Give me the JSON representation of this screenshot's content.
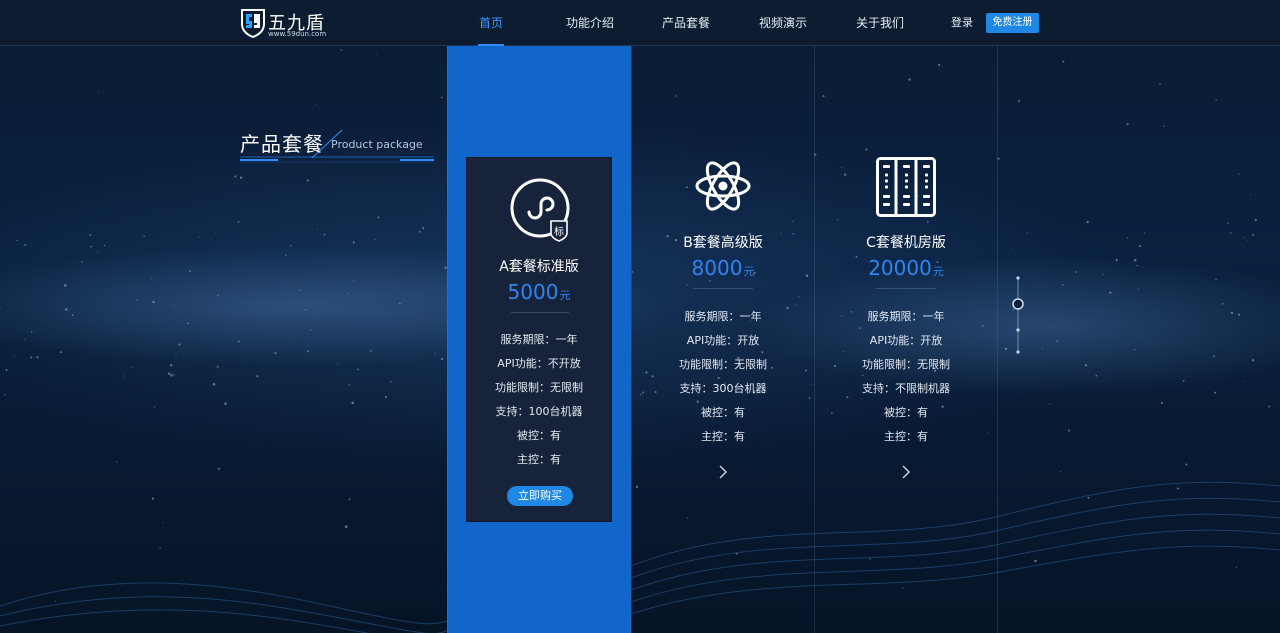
{
  "brand": {
    "name": "五九盾",
    "url": "www.59dun.com",
    "accent": "#1f88e5",
    "highlight": "#1265c9"
  },
  "nav": {
    "items": [
      {
        "label": "首页",
        "active": true
      },
      {
        "label": "功能介绍",
        "active": false
      },
      {
        "label": "产品套餐",
        "active": false
      },
      {
        "label": "视频演示",
        "active": false
      },
      {
        "label": "关于我们",
        "active": false
      }
    ],
    "login": "登录",
    "register": "免费注册"
  },
  "section": {
    "title": "产品套餐",
    "subtitle": "Product package"
  },
  "plans": [
    {
      "icon": "mini-program-icon",
      "badge": "标",
      "name": "A套餐标准版",
      "price": "5000",
      "unit": "元",
      "features": [
        "服务期限：一年",
        "API功能：不开放",
        "功能限制：无限制",
        "支持：100台机器",
        "被控：有",
        "主控：有"
      ],
      "button": "立即购买",
      "highlighted": true
    },
    {
      "icon": "atom-icon",
      "name": "B套餐高级版",
      "price": "8000",
      "unit": "元",
      "features": [
        "服务期限：一年",
        "API功能：开放",
        "功能限制：无限制",
        "支持：300台机器",
        "被控：有",
        "主控：有"
      ],
      "highlighted": false
    },
    {
      "icon": "server-rack-icon",
      "name": "C套餐机房版",
      "price": "20000",
      "unit": "元",
      "features": [
        "服务期限：一年",
        "API功能：开放",
        "功能限制：无限制",
        "支持：不限制机器",
        "被控：有",
        "主控：有"
      ],
      "highlighted": false
    }
  ],
  "pager": {
    "count": 4,
    "active": 1
  }
}
